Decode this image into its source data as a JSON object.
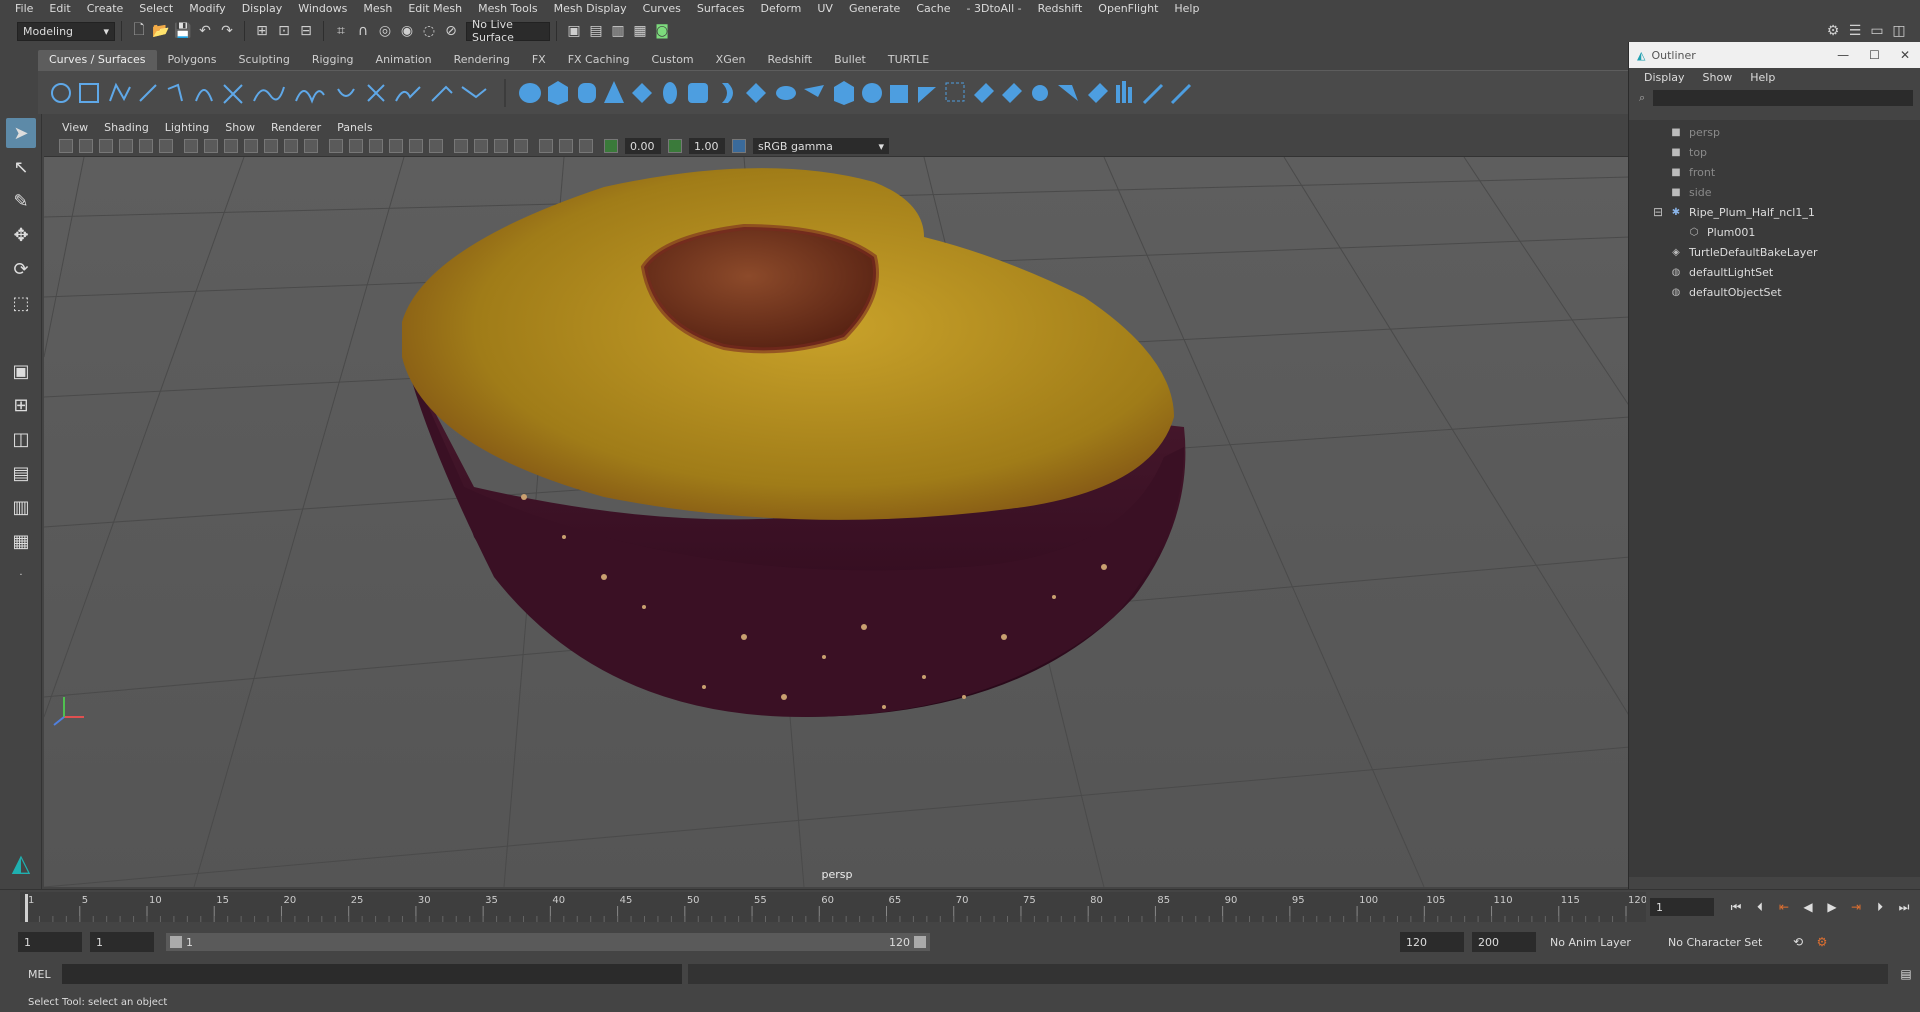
{
  "menubar": {
    "items": [
      "File",
      "Edit",
      "Create",
      "Select",
      "Modify",
      "Display",
      "Windows",
      "Mesh",
      "Edit Mesh",
      "Mesh Tools",
      "Mesh Display",
      "Curves",
      "Surfaces",
      "Deform",
      "UV",
      "Generate",
      "Cache",
      "- 3DtoAll -",
      "Redshift",
      "OpenFlight",
      "Help"
    ]
  },
  "statusline": {
    "mode": "Modeling",
    "live_surface": "No Live Surface"
  },
  "shelf": {
    "tabs": [
      "Curves / Surfaces",
      "Polygons",
      "Sculpting",
      "Rigging",
      "Animation",
      "Rendering",
      "FX",
      "FX Caching",
      "Custom",
      "XGen",
      "Redshift",
      "Bullet",
      "TURTLE"
    ],
    "active_tab": "Curves / Surfaces"
  },
  "viewport": {
    "menu": [
      "View",
      "Shading",
      "Lighting",
      "Show",
      "Renderer",
      "Panels"
    ],
    "exposure": "0.00",
    "gamma": "1.00",
    "color_space": "sRGB gamma",
    "camera_label": "persp"
  },
  "outliner": {
    "title": "Outliner",
    "menu": [
      "Display",
      "Show",
      "Help"
    ],
    "items": [
      {
        "label": "persp",
        "icon": "camera-icon",
        "dim": true,
        "indent": 0
      },
      {
        "label": "top",
        "icon": "camera-icon",
        "dim": true,
        "indent": 0
      },
      {
        "label": "front",
        "icon": "camera-icon",
        "dim": true,
        "indent": 0
      },
      {
        "label": "side",
        "icon": "camera-icon",
        "dim": true,
        "indent": 0
      },
      {
        "label": "Ripe_Plum_Half_ncl1_1",
        "icon": "group-icon",
        "dim": false,
        "indent": 0
      },
      {
        "label": "Plum001",
        "icon": "mesh-icon",
        "dim": false,
        "indent": 1
      },
      {
        "label": "TurtleDefaultBakeLayer",
        "icon": "node-icon",
        "dim": false,
        "indent": 0
      },
      {
        "label": "defaultLightSet",
        "icon": "set-icon",
        "dim": false,
        "indent": 0
      },
      {
        "label": "defaultObjectSet",
        "icon": "set-icon",
        "dim": false,
        "indent": 0
      }
    ]
  },
  "timeline": {
    "ticks": [
      "1",
      "5",
      "10",
      "15",
      "20",
      "25",
      "30",
      "35",
      "40",
      "45",
      "50",
      "55",
      "60",
      "65",
      "70",
      "75",
      "80",
      "85",
      "90",
      "95",
      "100",
      "105",
      "110",
      "115",
      "120"
    ],
    "current_frame": "1"
  },
  "range": {
    "start": "1",
    "playback_start": "1",
    "slider_start": "1",
    "slider_end": "120",
    "playback_end": "120",
    "end": "200",
    "anim_layer": "No Anim Layer",
    "character_set": "No Character Set"
  },
  "cmdline": {
    "label": "MEL"
  },
  "helpline": {
    "text": "Select Tool: select an object"
  },
  "colors": {
    "ui_bg": "#444444",
    "viewport_bg": "#5a5a5a",
    "active_tool": "#5d8aa8",
    "plum_flesh": "#b8921e",
    "plum_skin": "#3d1326",
    "plum_pit": "#7a3d22"
  }
}
